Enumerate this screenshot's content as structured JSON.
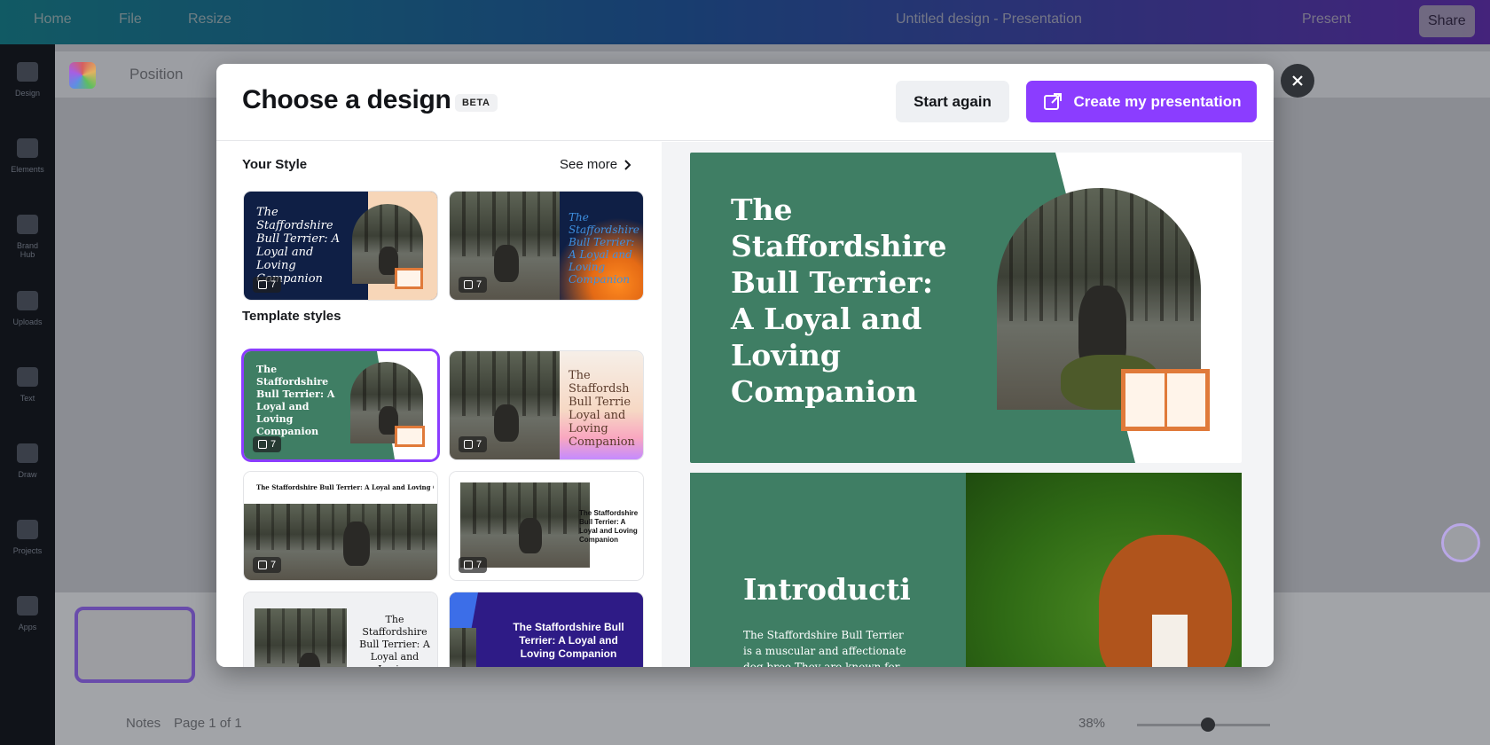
{
  "background": {
    "topbar": {
      "home": "Home",
      "file": "File",
      "resize": "Resize",
      "doc_title": "Untitled design - Presentation",
      "present": "Present",
      "share": "Share"
    },
    "toolbar": {
      "position": "Position"
    },
    "rail": [
      "Design",
      "Elements",
      "Brand Hub",
      "Uploads",
      "Text",
      "Draw",
      "Projects",
      "Apps"
    ],
    "status": {
      "notes": "Notes",
      "page": "Page 1 of 1",
      "zoom": "38%"
    }
  },
  "modal": {
    "title": "Choose a design",
    "badge": "BETA",
    "start_again": "Start again",
    "create": "Create my presentation",
    "your_style": "Your Style",
    "see_more": "See more",
    "template_styles": "Template styles",
    "card_count": "7",
    "cards": {
      "ys1_text": "The Staffordshire Bull Terrier: A Loyal and Loving Companion",
      "ys2_text": "The Staffordshire Bull Terrier: A Loyal and Loving Companion",
      "ts1_text": "The Staffordshire Bull Terrier: A Loyal and Loving Companion",
      "ts2_text": "The Staffordsh Bull Terrie Loyal and Loving Companion",
      "ts3_text": "The Staffordshire Bull Terrier: A Loyal and Loving Compa",
      "ts4_text": "The Staffordshire Bull Terrier: A Loyal and Loving Companion",
      "ts5_text": "The Staffordshire Bull Terrier: A Loyal and Loving",
      "ts6_text": "The Staffordshire Bull Terrier: A Loyal and Loving Companion"
    },
    "preview": {
      "slide1_title": "The Staffordshire Bull Terrier: A Loyal and Loving Companion",
      "slide2_heading": "Introductio",
      "slide2_body": "The Staffordshire Bull Terrier is a muscular and affectionate dog bree They are known for their loyalty"
    }
  },
  "colors": {
    "accent": "#8b3dff",
    "slide_green": "#3f7e64",
    "book_orange": "#e07a3a"
  }
}
